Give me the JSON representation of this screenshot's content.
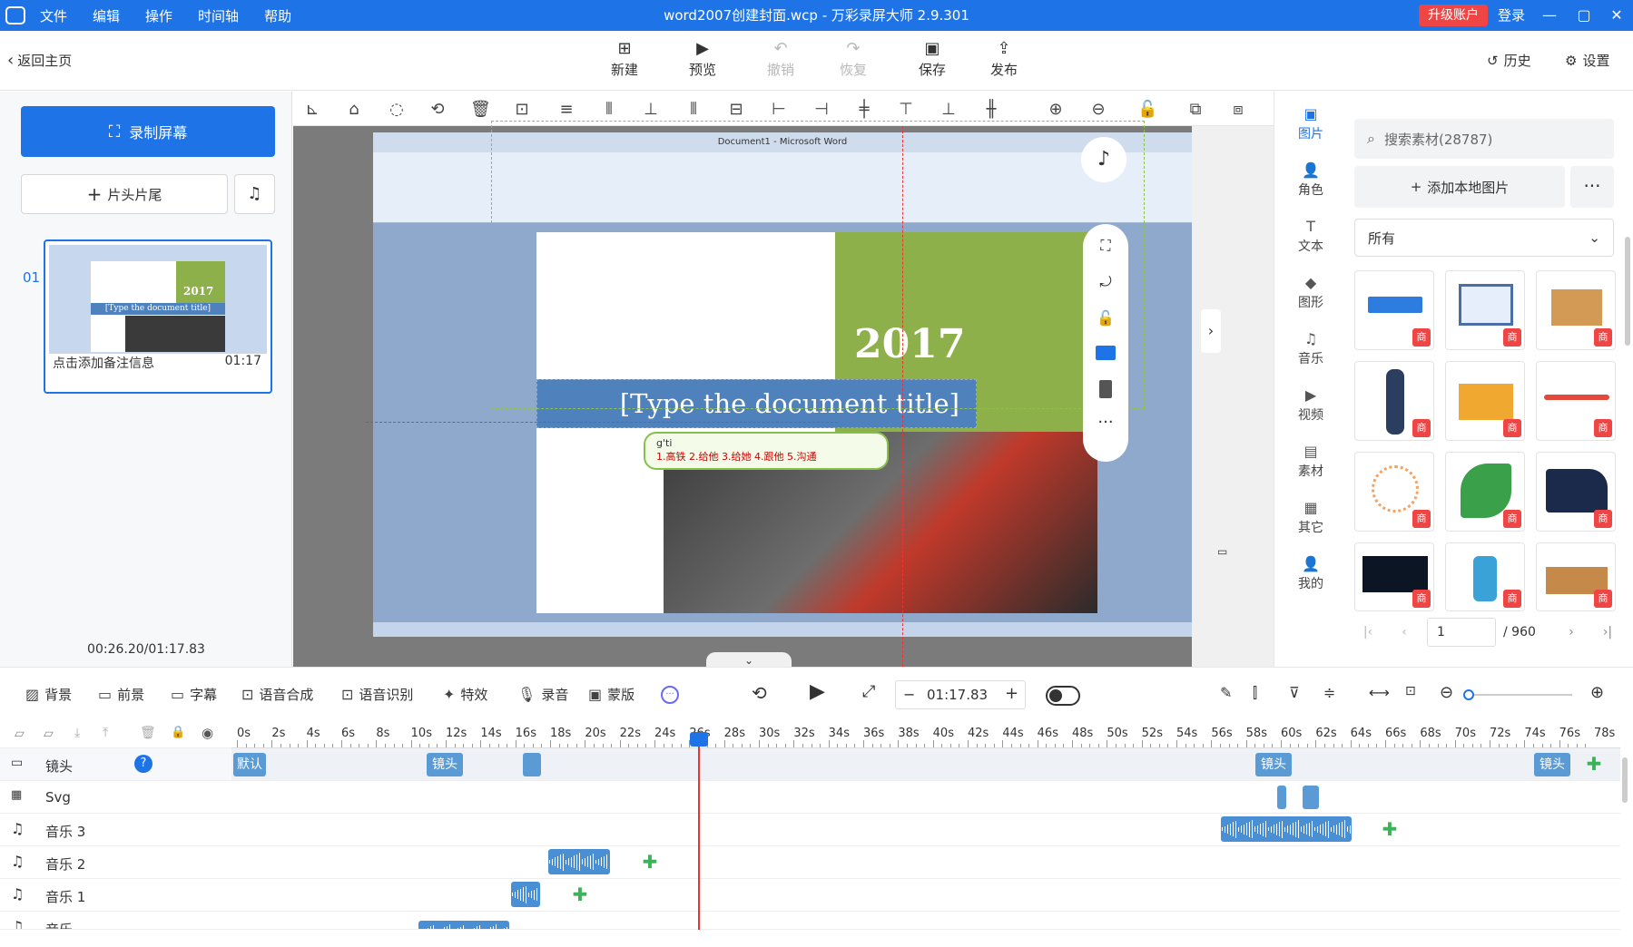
{
  "titlebar": {
    "menu": [
      "文件",
      "编辑",
      "操作",
      "时间轴",
      "帮助"
    ],
    "title": "word2007创建封面.wcp - 万彩录屏大师 2.9.301",
    "upgrade": "升级账户",
    "login": "登录"
  },
  "toolbar": {
    "back": "返回主页",
    "new": "新建",
    "preview": "预览",
    "undo": "撤销",
    "redo": "恢复",
    "save": "保存",
    "publish": "发布",
    "history": "历史",
    "settings": "设置"
  },
  "left": {
    "record": "录制屏幕",
    "clip": "片头片尾",
    "scene_index": "01",
    "scene_note": "点击添加备注信息",
    "scene_duration": "01:17",
    "time_readout": "00:26.20/01:17.83"
  },
  "stage": {
    "word_title": "Document1 - Microsoft Word",
    "year": "2017",
    "doc_title": "[Type the document title]",
    "ime_pinyin": "g'ti",
    "ime_candidates": "1.高铁  2.给他  3.给她  4.跟他  5.沟通"
  },
  "right": {
    "categories": [
      "图片",
      "角色",
      "文本",
      "图形",
      "音乐",
      "视频",
      "素材",
      "其它",
      "我的"
    ],
    "search_placeholder": "搜索素材(28787)",
    "add_local": "添加本地图片",
    "filter": "所有",
    "badge": "商",
    "page": "1",
    "total": "/ 960"
  },
  "tltools": {
    "bg": "背景",
    "fg": "前景",
    "subtitle": "字幕",
    "tts": "语音合成",
    "asr": "语音识别",
    "effect": "特效",
    "record": "录音",
    "mask": "蒙版",
    "duration": "01:17.83"
  },
  "timeline": {
    "ticks": [
      "0s",
      "2s",
      "4s",
      "6s",
      "8s",
      "10s",
      "12s",
      "14s",
      "16s",
      "18s",
      "20s",
      "22s",
      "24s",
      "26s",
      "28s",
      "30s",
      "32s",
      "34s",
      "36s",
      "38s",
      "40s",
      "42s",
      "44s",
      "46s",
      "48s",
      "50s",
      "52s",
      "54s",
      "56s",
      "58s",
      "60s",
      "62s",
      "64s",
      "66s",
      "68s",
      "70s",
      "72s",
      "74s",
      "76s",
      "78s"
    ],
    "tracks": [
      "镜头",
      "Svg",
      "音乐 3",
      "音乐 2",
      "音乐 1",
      "音乐"
    ],
    "cam_default": "默认",
    "cam_label": "镜头"
  }
}
